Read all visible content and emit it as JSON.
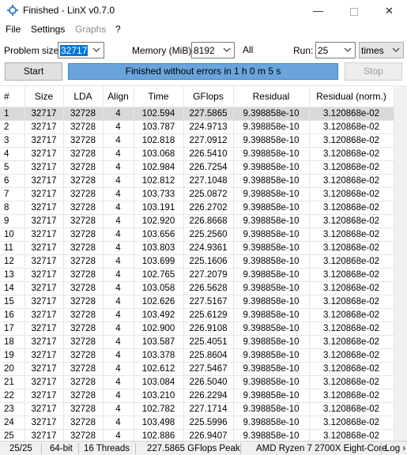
{
  "window": {
    "title": "Finished - LinX v0.7.0",
    "minimize": "—",
    "close": "✕"
  },
  "menu": {
    "file": "File",
    "settings": "Settings",
    "graphs": "Graphs",
    "help": "?"
  },
  "controls": {
    "problem_size_label": "Problem size:",
    "problem_size_value": "32717",
    "memory_label": "Memory (MiB):",
    "memory_value": "8192",
    "all_label": "All",
    "run_label": "Run:",
    "run_value": "25",
    "run_unit_value": "times"
  },
  "buttons": {
    "start": "Start",
    "stop": "Stop"
  },
  "progress": {
    "text": "Finished without errors in 1 h 0 m 5 s",
    "fraction": 1.0
  },
  "table": {
    "columns": [
      "#",
      "Size",
      "LDA",
      "Align",
      "Time",
      "GFlops",
      "Residual",
      "Residual (norm.)"
    ],
    "rows": [
      [
        "1",
        "32717",
        "32728",
        "4",
        "102.594",
        "227.5865",
        "9.398858e-10",
        "3.120868e-02"
      ],
      [
        "2",
        "32717",
        "32728",
        "4",
        "103.787",
        "224.9713",
        "9.398858e-10",
        "3.120868e-02"
      ],
      [
        "3",
        "32717",
        "32728",
        "4",
        "102.818",
        "227.0912",
        "9.398858e-10",
        "3.120868e-02"
      ],
      [
        "4",
        "32717",
        "32728",
        "4",
        "103.068",
        "226.5410",
        "9.398858e-10",
        "3.120868e-02"
      ],
      [
        "5",
        "32717",
        "32728",
        "4",
        "102.984",
        "226.7254",
        "9.398858e-10",
        "3.120868e-02"
      ],
      [
        "6",
        "32717",
        "32728",
        "4",
        "102.812",
        "227.1048",
        "9.398858e-10",
        "3.120868e-02"
      ],
      [
        "7",
        "32717",
        "32728",
        "4",
        "103.733",
        "225.0872",
        "9.398858e-10",
        "3.120868e-02"
      ],
      [
        "8",
        "32717",
        "32728",
        "4",
        "103.191",
        "226.2702",
        "9.398858e-10",
        "3.120868e-02"
      ],
      [
        "9",
        "32717",
        "32728",
        "4",
        "102.920",
        "226.8668",
        "9.398858e-10",
        "3.120868e-02"
      ],
      [
        "10",
        "32717",
        "32728",
        "4",
        "103.656",
        "225.2560",
        "9.398858e-10",
        "3.120868e-02"
      ],
      [
        "11",
        "32717",
        "32728",
        "4",
        "103.803",
        "224.9361",
        "9.398858e-10",
        "3.120868e-02"
      ],
      [
        "12",
        "32717",
        "32728",
        "4",
        "103.699",
        "225.1606",
        "9.398858e-10",
        "3.120868e-02"
      ],
      [
        "13",
        "32717",
        "32728",
        "4",
        "102.765",
        "227.2079",
        "9.398858e-10",
        "3.120868e-02"
      ],
      [
        "14",
        "32717",
        "32728",
        "4",
        "103.058",
        "226.5628",
        "9.398858e-10",
        "3.120868e-02"
      ],
      [
        "15",
        "32717",
        "32728",
        "4",
        "102.626",
        "227.5167",
        "9.398858e-10",
        "3.120868e-02"
      ],
      [
        "16",
        "32717",
        "32728",
        "4",
        "103.492",
        "225.6129",
        "9.398858e-10",
        "3.120868e-02"
      ],
      [
        "17",
        "32717",
        "32728",
        "4",
        "102.900",
        "226.9108",
        "9.398858e-10",
        "3.120868e-02"
      ],
      [
        "18",
        "32717",
        "32728",
        "4",
        "103.587",
        "225.4051",
        "9.398858e-10",
        "3.120868e-02"
      ],
      [
        "19",
        "32717",
        "32728",
        "4",
        "103.378",
        "225.8604",
        "9.398858e-10",
        "3.120868e-02"
      ],
      [
        "20",
        "32717",
        "32728",
        "4",
        "102.612",
        "227.5467",
        "9.398858e-10",
        "3.120868e-02"
      ],
      [
        "21",
        "32717",
        "32728",
        "4",
        "103.084",
        "226.5040",
        "9.398858e-10",
        "3.120868e-02"
      ],
      [
        "22",
        "32717",
        "32728",
        "4",
        "103.210",
        "226.2294",
        "9.398858e-10",
        "3.120868e-02"
      ],
      [
        "23",
        "32717",
        "32728",
        "4",
        "102.782",
        "227.1714",
        "9.398858e-10",
        "3.120868e-02"
      ],
      [
        "24",
        "32717",
        "32728",
        "4",
        "103.498",
        "225.5996",
        "9.398858e-10",
        "3.120868e-02"
      ],
      [
        "25",
        "32717",
        "32728",
        "4",
        "102.886",
        "226.9407",
        "9.398858e-10",
        "3.120868e-02"
      ]
    ]
  },
  "statusbar": {
    "progress": "25/25",
    "arch": "64-bit",
    "threads": "16 Threads",
    "peak": "227.5865 GFlops Peak",
    "cpu": "AMD Ryzen 7 2700X Eight-Core",
    "log": "Log ›"
  },
  "colors": {
    "progress_fill": "#6aa4dc",
    "selection": "#0078d7",
    "selected_row": "#d9d9d9"
  }
}
